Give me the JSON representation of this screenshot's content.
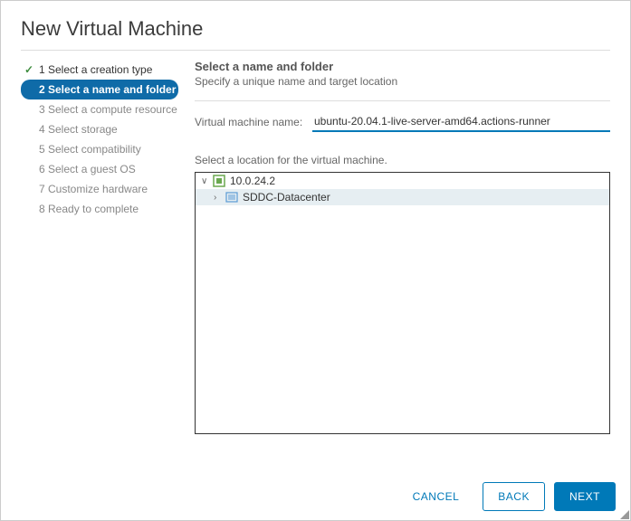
{
  "title": "New Virtual Machine",
  "steps": [
    {
      "label": "1 Select a creation type",
      "state": "done"
    },
    {
      "label": "2 Select a name and folder",
      "state": "active"
    },
    {
      "label": "3 Select a compute resource",
      "state": "future"
    },
    {
      "label": "4 Select storage",
      "state": "future"
    },
    {
      "label": "5 Select compatibility",
      "state": "future"
    },
    {
      "label": "6 Select a guest OS",
      "state": "future"
    },
    {
      "label": "7 Customize hardware",
      "state": "future"
    },
    {
      "label": "8 Ready to complete",
      "state": "future"
    }
  ],
  "panel": {
    "heading": "Select a name and folder",
    "subheading": "Specify a unique name and target location",
    "name_label": "Virtual machine name:",
    "name_value": "ubuntu-20.04.1-live-server-amd64.actions-runner",
    "location_label": "Select a location for the virtual machine."
  },
  "tree": {
    "root_label": "10.0.24.2",
    "child_label": "SDDC-Datacenter"
  },
  "buttons": {
    "cancel": "CANCEL",
    "back": "BACK",
    "next": "NEXT"
  }
}
